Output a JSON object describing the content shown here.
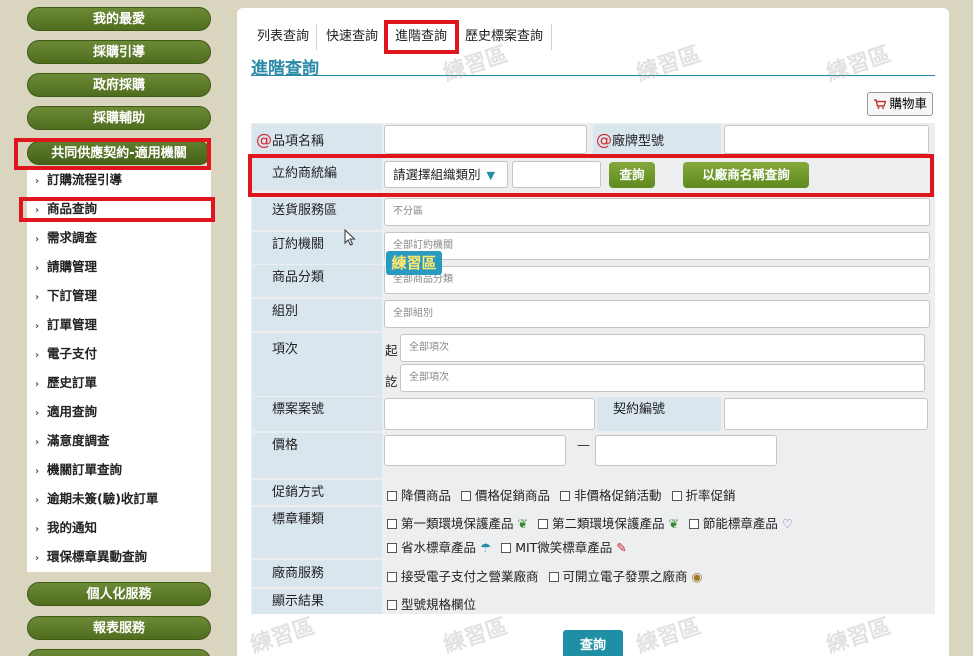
{
  "sidebar": {
    "top_items": [
      {
        "label": "我的最愛"
      },
      {
        "label": "採購引導"
      },
      {
        "label": "政府採購"
      },
      {
        "label": "採購輔助"
      },
      {
        "label": "共同供應契約-適用機關"
      }
    ],
    "sub_items": [
      {
        "label": "訂購流程引導"
      },
      {
        "label": "商品查詢"
      },
      {
        "label": "需求調查"
      },
      {
        "label": "請購管理"
      },
      {
        "label": "下訂管理"
      },
      {
        "label": "訂單管理"
      },
      {
        "label": "電子支付"
      },
      {
        "label": "歷史訂單"
      },
      {
        "label": "適用查詢"
      },
      {
        "label": "滿意度調查"
      },
      {
        "label": "機關訂單查詢"
      },
      {
        "label": "逾期未簽(驗)收訂單"
      },
      {
        "label": "我的通知"
      },
      {
        "label": "環保標章異動查詢"
      }
    ],
    "bottom_items": [
      {
        "label": "個人化服務"
      },
      {
        "label": "報表服務"
      }
    ]
  },
  "tabs": [
    {
      "label": "列表查詢"
    },
    {
      "label": "快速查詢"
    },
    {
      "label": "進階查詢"
    },
    {
      "label": "歷史標案查詢"
    }
  ],
  "page_title": "進階查詢",
  "cart_label": "購物車",
  "form": {
    "item_name_label": "品項名稱",
    "brand_label": "廠牌型號",
    "at_mark": "@",
    "vendor_id_label": "立約商統編",
    "org_type_select": "請選擇組織類別",
    "search_btn": "查詢",
    "search_by_name_btn": "以廠商名稱查詢",
    "delivery_label": "送貨服務區",
    "delivery_value": "不分區",
    "org_label": "訂約機關",
    "org_value": "全部訂約機關",
    "category_label": "商品分類",
    "category_value": "全部商品分類",
    "group_label": "組別",
    "group_value": "全部組別",
    "item_no_label": "項次",
    "from_label": "起",
    "to_label": "訖",
    "item_from_value": "全部項次",
    "item_to_value": "全部項次",
    "case_no_label": "標案案號",
    "contract_no_label": "契約編號",
    "price_label": "價格",
    "price_dash": "—",
    "promo_label": "促銷方式",
    "promo_options": [
      "降價商品",
      "價格促銷商品",
      "非價格促銷活動",
      "折率促銷"
    ],
    "mark_label": "標章種類",
    "mark_options": [
      "第一類環境保護產品",
      "第二類環境保護產品",
      "節能標章產品",
      "省水標章產品",
      "MIT微笑標章產品"
    ],
    "vendor_service_label": "廠商服務",
    "vendor_service_options": [
      "接受電子支付之營業廠商",
      "可開立電子發票之廠商"
    ],
    "display_label": "顯示結果",
    "display_options": [
      "型號規格欄位"
    ]
  },
  "submit_label": "查詢",
  "overlay_badge": "練習區",
  "watermark_text": "練習區",
  "colors": {
    "accent": "#2a8aa8",
    "green": "#5f8a1d",
    "highlight": "#e0161e"
  }
}
